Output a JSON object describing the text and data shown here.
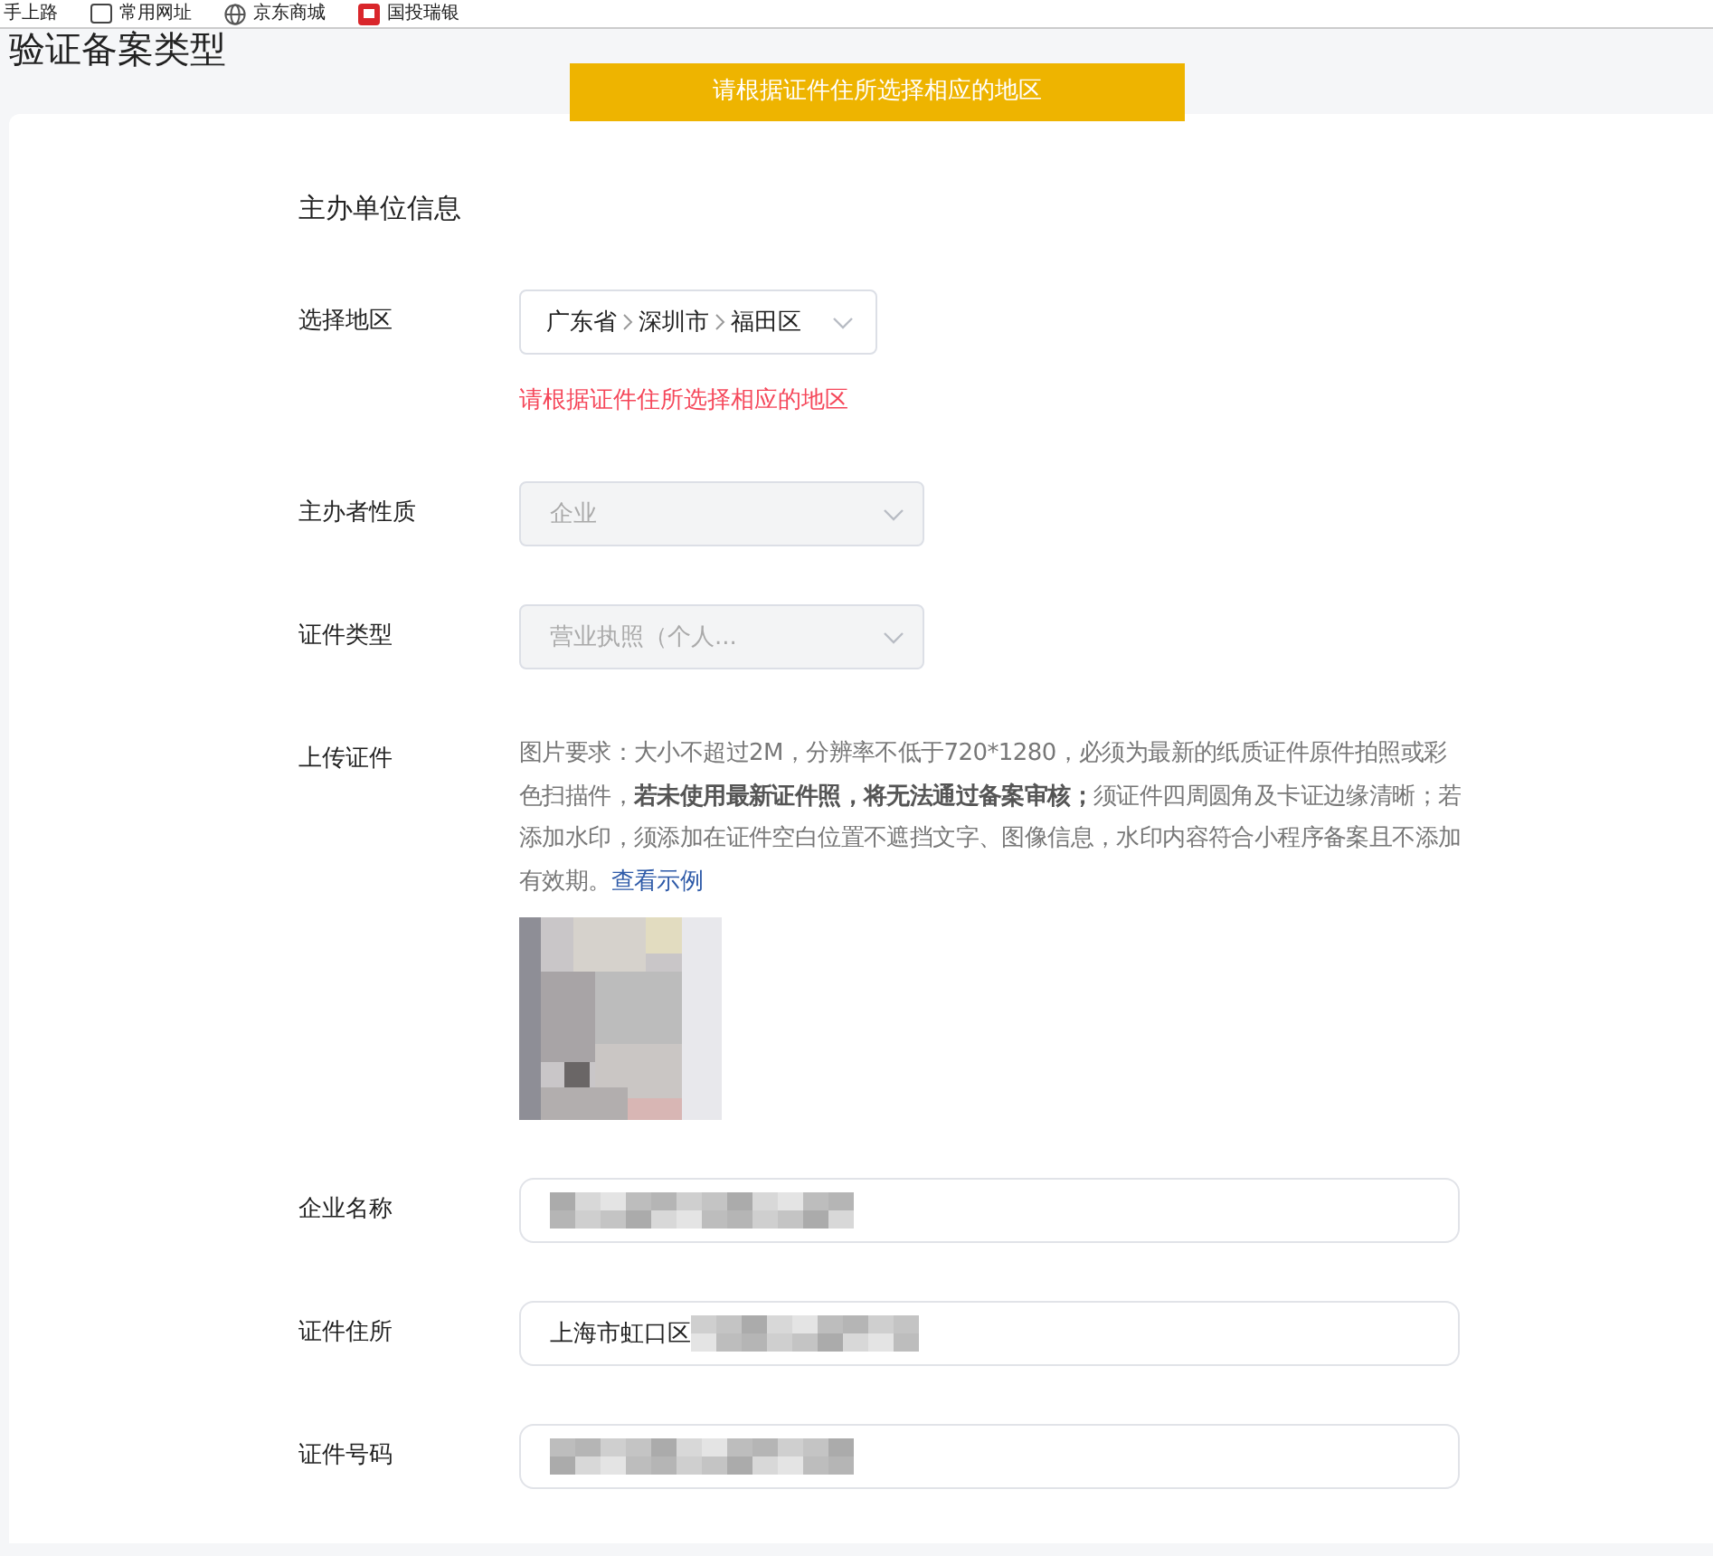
{
  "bookmarks": [
    {
      "label": "手上路",
      "kind": "plain"
    },
    {
      "label": "常用网址",
      "kind": "folder"
    },
    {
      "label": "京东商城",
      "kind": "site"
    },
    {
      "label": "国投瑞银",
      "kind": "logo"
    }
  ],
  "page_title": "验证备案类型",
  "toast": "请根据证件住所选择相应的地区",
  "section_title": "主办单位信息",
  "fields": [
    {
      "kind": "region",
      "label": "选择地区",
      "parts": [
        "广东省",
        "深圳市",
        "福田区"
      ],
      "error": "请根据证件住所选择相应的地区"
    },
    {
      "kind": "select",
      "label": "主办者性质",
      "value": "企业",
      "disabled": true
    },
    {
      "kind": "select",
      "label": "证件类型",
      "value": "营业执照（个人...",
      "disabled": true
    },
    {
      "kind": "upload",
      "label": "上传证件",
      "hint": "图片要求：大小不超过2M，分辨率不低于720*1280，必须为最新的纸质证件原件拍照或彩色扫描件，**若未使用最新证件照，将无法通过备案审核；**须证件四周圆角及卡证边缘清晰；若添加水印，须添加在证件空白位置不遮挡文字、图像信息，水印内容符合小程序备案且不添加有效期。",
      "link": "查看示例"
    },
    {
      "kind": "text",
      "label": "企业名称",
      "redacted": true
    },
    {
      "kind": "text",
      "label": "证件住所",
      "value": "上海市虹口区",
      "redacted": true
    },
    {
      "kind": "text",
      "label": "证件号码",
      "redacted": true
    }
  ]
}
